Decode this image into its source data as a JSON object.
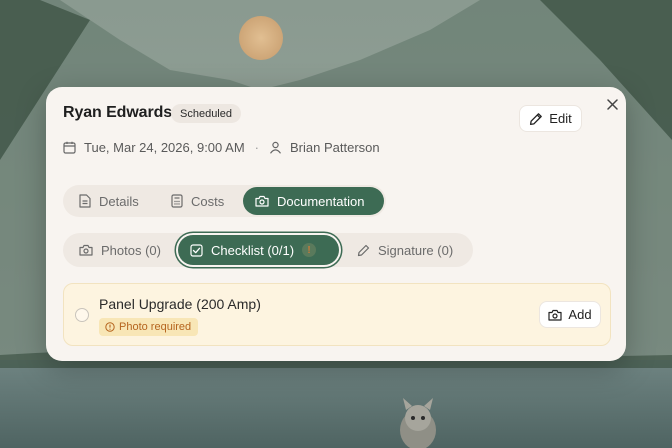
{
  "modal": {
    "title": "Ryan Edwards",
    "status": "Scheduled",
    "edit_label": "Edit",
    "datetime": "Tue, Mar 24, 2026, 9:00 AM",
    "separator": "·",
    "assignee": "Brian Patterson"
  },
  "main_tabs": [
    {
      "label": "Details",
      "icon": "document-icon",
      "active": false
    },
    {
      "label": "Costs",
      "icon": "calculator-icon",
      "active": false
    },
    {
      "label": "Documentation",
      "icon": "camera-icon",
      "active": true
    }
  ],
  "sub_tabs": [
    {
      "label": "Photos (0)",
      "icon": "camera-icon",
      "active": false
    },
    {
      "label": "Checklist (0/1)",
      "icon": "checkbox-icon",
      "active": true,
      "badge": "!"
    },
    {
      "label": "Signature (0)",
      "icon": "pen-icon",
      "active": false
    }
  ],
  "checklist": [
    {
      "title": "Panel Upgrade (200 Amp)",
      "badge": "Photo required",
      "action_label": "Add",
      "checked": false
    }
  ],
  "colors": {
    "accent": "#3d6b54",
    "card_bg": "#f8f4f0",
    "item_bg": "#fdf4e0",
    "warning_text": "#b5641e"
  }
}
